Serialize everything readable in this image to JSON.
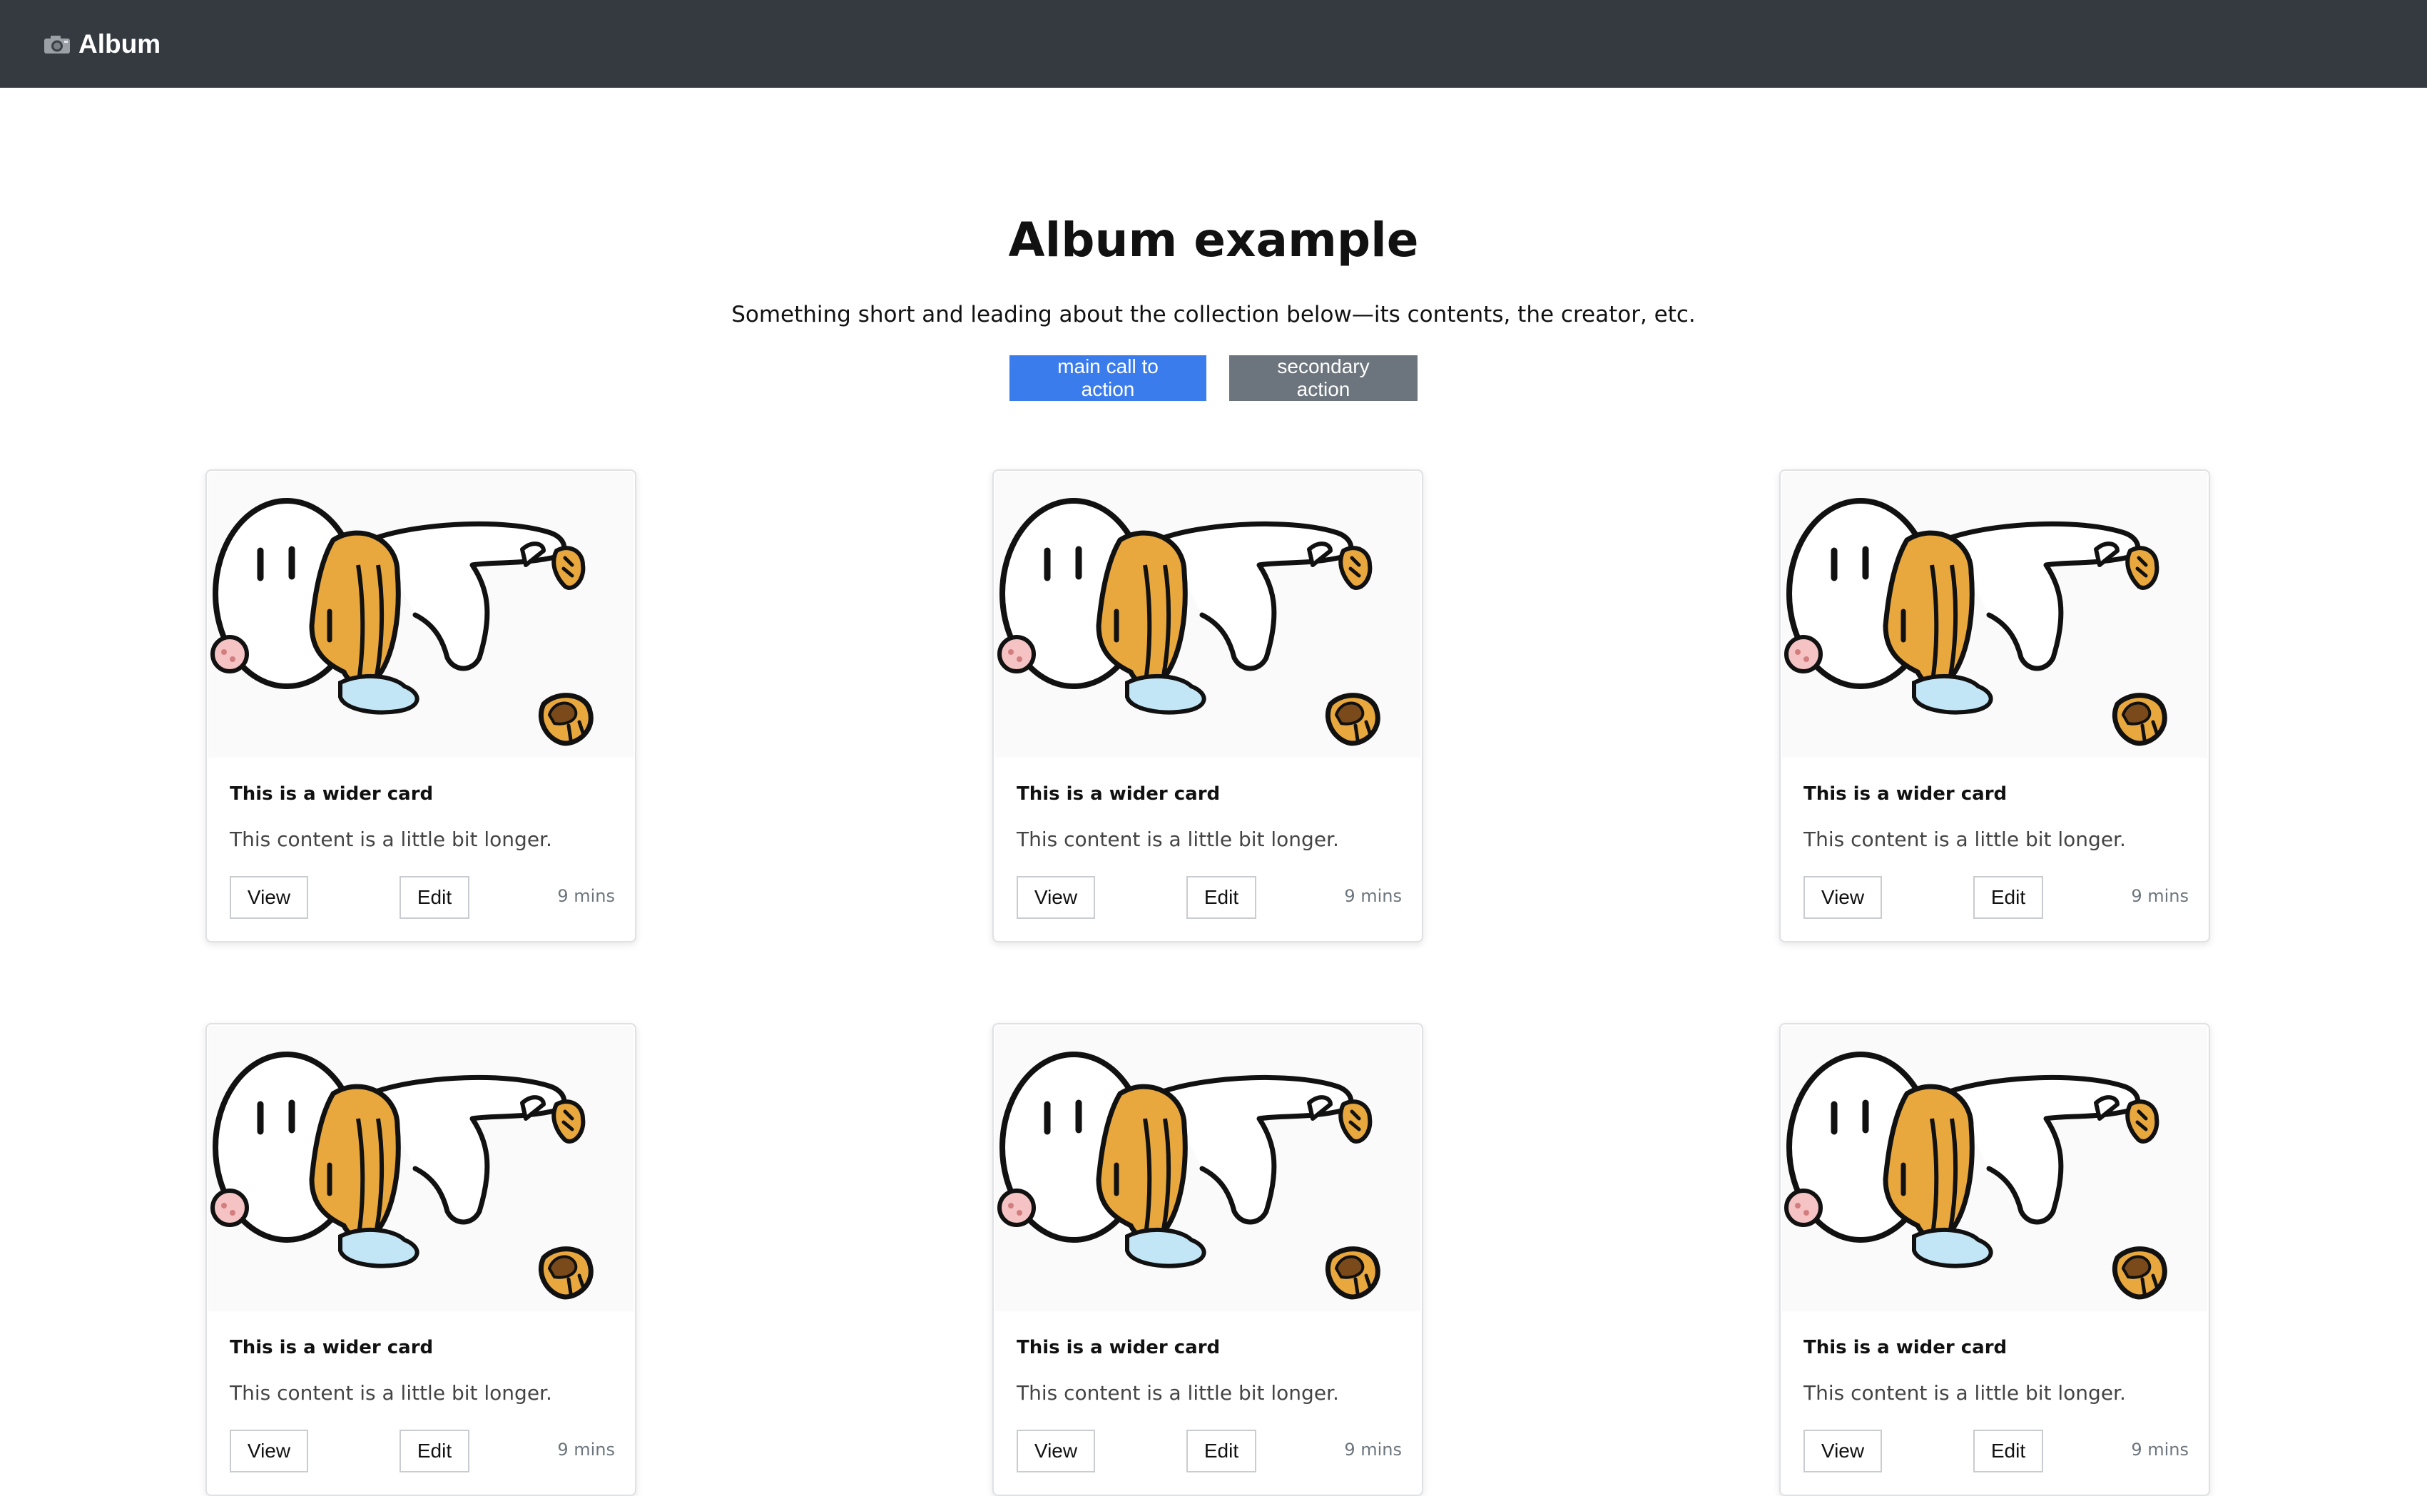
{
  "navbar": {
    "brand": "Album",
    "icon": "camera-icon"
  },
  "hero": {
    "title": "Album example",
    "lead": "Something short and leading about the collection below—its contents, the creator, etc.",
    "primary_label": "main call to action",
    "secondary_label": "secondary action"
  },
  "cards": [
    {
      "title": "This is a wider card",
      "text": "This content is a little bit longer.",
      "view_label": "View",
      "edit_label": "Edit",
      "time": "9 mins",
      "image": "cartoon-character-image"
    },
    {
      "title": "This is a wider card",
      "text": "This content is a little bit longer.",
      "view_label": "View",
      "edit_label": "Edit",
      "time": "9 mins",
      "image": "cartoon-character-image"
    },
    {
      "title": "This is a wider card",
      "text": "This content is a little bit longer.",
      "view_label": "View",
      "edit_label": "Edit",
      "time": "9 mins",
      "image": "cartoon-character-image"
    },
    {
      "title": "This is a wider card",
      "text": "This content is a little bit longer.",
      "view_label": "View",
      "edit_label": "Edit",
      "time": "9 mins",
      "image": "cartoon-character-image"
    },
    {
      "title": "This is a wider card",
      "text": "This content is a little bit longer.",
      "view_label": "View",
      "edit_label": "Edit",
      "time": "9 mins",
      "image": "cartoon-character-image"
    },
    {
      "title": "This is a wider card",
      "text": "This content is a little bit longer.",
      "view_label": "View",
      "edit_label": "Edit",
      "time": "9 mins",
      "image": "cartoon-character-image"
    }
  ],
  "colors": {
    "navbar_bg": "#343a40",
    "primary": "#3b7ced",
    "secondary": "#6c757d",
    "character_ear": "#e8a83e"
  }
}
